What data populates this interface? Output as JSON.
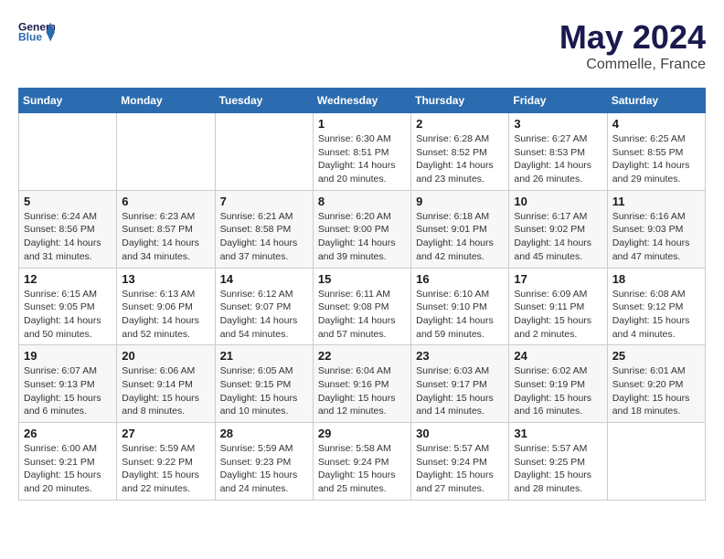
{
  "header": {
    "logo_line1": "General",
    "logo_line2": "Blue",
    "month": "May 2024",
    "location": "Commelle, France"
  },
  "weekdays": [
    "Sunday",
    "Monday",
    "Tuesday",
    "Wednesday",
    "Thursday",
    "Friday",
    "Saturday"
  ],
  "weeks": [
    [
      {
        "day": "",
        "info": ""
      },
      {
        "day": "",
        "info": ""
      },
      {
        "day": "",
        "info": ""
      },
      {
        "day": "1",
        "info": "Sunrise: 6:30 AM\nSunset: 8:51 PM\nDaylight: 14 hours\nand 20 minutes."
      },
      {
        "day": "2",
        "info": "Sunrise: 6:28 AM\nSunset: 8:52 PM\nDaylight: 14 hours\nand 23 minutes."
      },
      {
        "day": "3",
        "info": "Sunrise: 6:27 AM\nSunset: 8:53 PM\nDaylight: 14 hours\nand 26 minutes."
      },
      {
        "day": "4",
        "info": "Sunrise: 6:25 AM\nSunset: 8:55 PM\nDaylight: 14 hours\nand 29 minutes."
      }
    ],
    [
      {
        "day": "5",
        "info": "Sunrise: 6:24 AM\nSunset: 8:56 PM\nDaylight: 14 hours\nand 31 minutes."
      },
      {
        "day": "6",
        "info": "Sunrise: 6:23 AM\nSunset: 8:57 PM\nDaylight: 14 hours\nand 34 minutes."
      },
      {
        "day": "7",
        "info": "Sunrise: 6:21 AM\nSunset: 8:58 PM\nDaylight: 14 hours\nand 37 minutes."
      },
      {
        "day": "8",
        "info": "Sunrise: 6:20 AM\nSunset: 9:00 PM\nDaylight: 14 hours\nand 39 minutes."
      },
      {
        "day": "9",
        "info": "Sunrise: 6:18 AM\nSunset: 9:01 PM\nDaylight: 14 hours\nand 42 minutes."
      },
      {
        "day": "10",
        "info": "Sunrise: 6:17 AM\nSunset: 9:02 PM\nDaylight: 14 hours\nand 45 minutes."
      },
      {
        "day": "11",
        "info": "Sunrise: 6:16 AM\nSunset: 9:03 PM\nDaylight: 14 hours\nand 47 minutes."
      }
    ],
    [
      {
        "day": "12",
        "info": "Sunrise: 6:15 AM\nSunset: 9:05 PM\nDaylight: 14 hours\nand 50 minutes."
      },
      {
        "day": "13",
        "info": "Sunrise: 6:13 AM\nSunset: 9:06 PM\nDaylight: 14 hours\nand 52 minutes."
      },
      {
        "day": "14",
        "info": "Sunrise: 6:12 AM\nSunset: 9:07 PM\nDaylight: 14 hours\nand 54 minutes."
      },
      {
        "day": "15",
        "info": "Sunrise: 6:11 AM\nSunset: 9:08 PM\nDaylight: 14 hours\nand 57 minutes."
      },
      {
        "day": "16",
        "info": "Sunrise: 6:10 AM\nSunset: 9:10 PM\nDaylight: 14 hours\nand 59 minutes."
      },
      {
        "day": "17",
        "info": "Sunrise: 6:09 AM\nSunset: 9:11 PM\nDaylight: 15 hours\nand 2 minutes."
      },
      {
        "day": "18",
        "info": "Sunrise: 6:08 AM\nSunset: 9:12 PM\nDaylight: 15 hours\nand 4 minutes."
      }
    ],
    [
      {
        "day": "19",
        "info": "Sunrise: 6:07 AM\nSunset: 9:13 PM\nDaylight: 15 hours\nand 6 minutes."
      },
      {
        "day": "20",
        "info": "Sunrise: 6:06 AM\nSunset: 9:14 PM\nDaylight: 15 hours\nand 8 minutes."
      },
      {
        "day": "21",
        "info": "Sunrise: 6:05 AM\nSunset: 9:15 PM\nDaylight: 15 hours\nand 10 minutes."
      },
      {
        "day": "22",
        "info": "Sunrise: 6:04 AM\nSunset: 9:16 PM\nDaylight: 15 hours\nand 12 minutes."
      },
      {
        "day": "23",
        "info": "Sunrise: 6:03 AM\nSunset: 9:17 PM\nDaylight: 15 hours\nand 14 minutes."
      },
      {
        "day": "24",
        "info": "Sunrise: 6:02 AM\nSunset: 9:19 PM\nDaylight: 15 hours\nand 16 minutes."
      },
      {
        "day": "25",
        "info": "Sunrise: 6:01 AM\nSunset: 9:20 PM\nDaylight: 15 hours\nand 18 minutes."
      }
    ],
    [
      {
        "day": "26",
        "info": "Sunrise: 6:00 AM\nSunset: 9:21 PM\nDaylight: 15 hours\nand 20 minutes."
      },
      {
        "day": "27",
        "info": "Sunrise: 5:59 AM\nSunset: 9:22 PM\nDaylight: 15 hours\nand 22 minutes."
      },
      {
        "day": "28",
        "info": "Sunrise: 5:59 AM\nSunset: 9:23 PM\nDaylight: 15 hours\nand 24 minutes."
      },
      {
        "day": "29",
        "info": "Sunrise: 5:58 AM\nSunset: 9:24 PM\nDaylight: 15 hours\nand 25 minutes."
      },
      {
        "day": "30",
        "info": "Sunrise: 5:57 AM\nSunset: 9:24 PM\nDaylight: 15 hours\nand 27 minutes."
      },
      {
        "day": "31",
        "info": "Sunrise: 5:57 AM\nSunset: 9:25 PM\nDaylight: 15 hours\nand 28 minutes."
      },
      {
        "day": "",
        "info": ""
      }
    ]
  ]
}
